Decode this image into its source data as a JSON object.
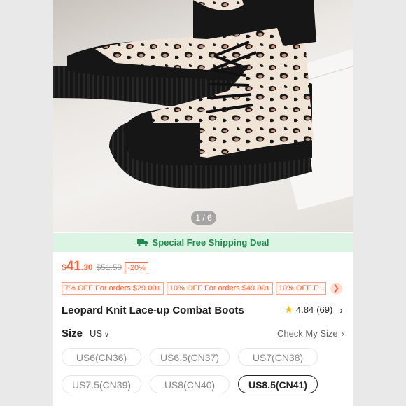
{
  "gallery": {
    "counter": "1 / 6",
    "current": 1,
    "total": 6
  },
  "shipping": {
    "label": "Special Free Shipping Deal",
    "icon": "truck-icon"
  },
  "price": {
    "currency": "$",
    "integer": "41",
    "decimal": ".30",
    "original": "$51.50",
    "discount": "-20%"
  },
  "coupons": [
    "7% OFF For orders $29.00+",
    "10% OFF For orders $49.00+",
    "10% OFF F ..."
  ],
  "product": {
    "title": "Leopard Knit Lace-up Combat Boots"
  },
  "rating": {
    "score": "4.84",
    "count": "(69)"
  },
  "size": {
    "label": "Size",
    "unit": "US",
    "check_link": "Check My Size",
    "options": [
      "US6(CN36)",
      "US6.5(CN37)",
      "US7(CN38)",
      "US7.5(CN39)",
      "US8(CN40)",
      "US8.5(CN41)"
    ],
    "selected": "US8.5(CN41)"
  },
  "colors": {
    "accent": "#fa6338",
    "shipping_green": "#1f8a4c",
    "shipping_bg": "#dcf4e3",
    "star": "#f5b400"
  }
}
